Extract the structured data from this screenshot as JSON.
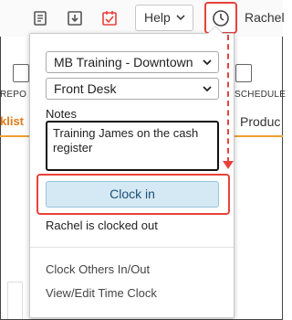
{
  "header": {
    "help_label": "Help",
    "user_name": "Rachel"
  },
  "background": {
    "nav_labels": [
      "REPO",
      "SCHEDULE"
    ],
    "checklist_label": "klist",
    "products_label": "Produc"
  },
  "time_clock": {
    "location_select": "MB Training - Downtown",
    "role_select": "Front Desk",
    "notes_label": "Notes",
    "notes_value": "Training James on the cash register",
    "clock_in_label": "Clock in",
    "status_text": "Rachel is clocked out",
    "links": [
      "Clock Others In/Out",
      "View/Edit Time Clock"
    ]
  },
  "colors": {
    "highlight": "#e8413c",
    "button_bg": "#d5e9f4",
    "button_text": "#1c4f79",
    "tab_accent": "#f0a030"
  },
  "icons": [
    "report-icon",
    "download-icon",
    "checklist-icon",
    "chevron-down-icon",
    "clock-icon"
  ]
}
